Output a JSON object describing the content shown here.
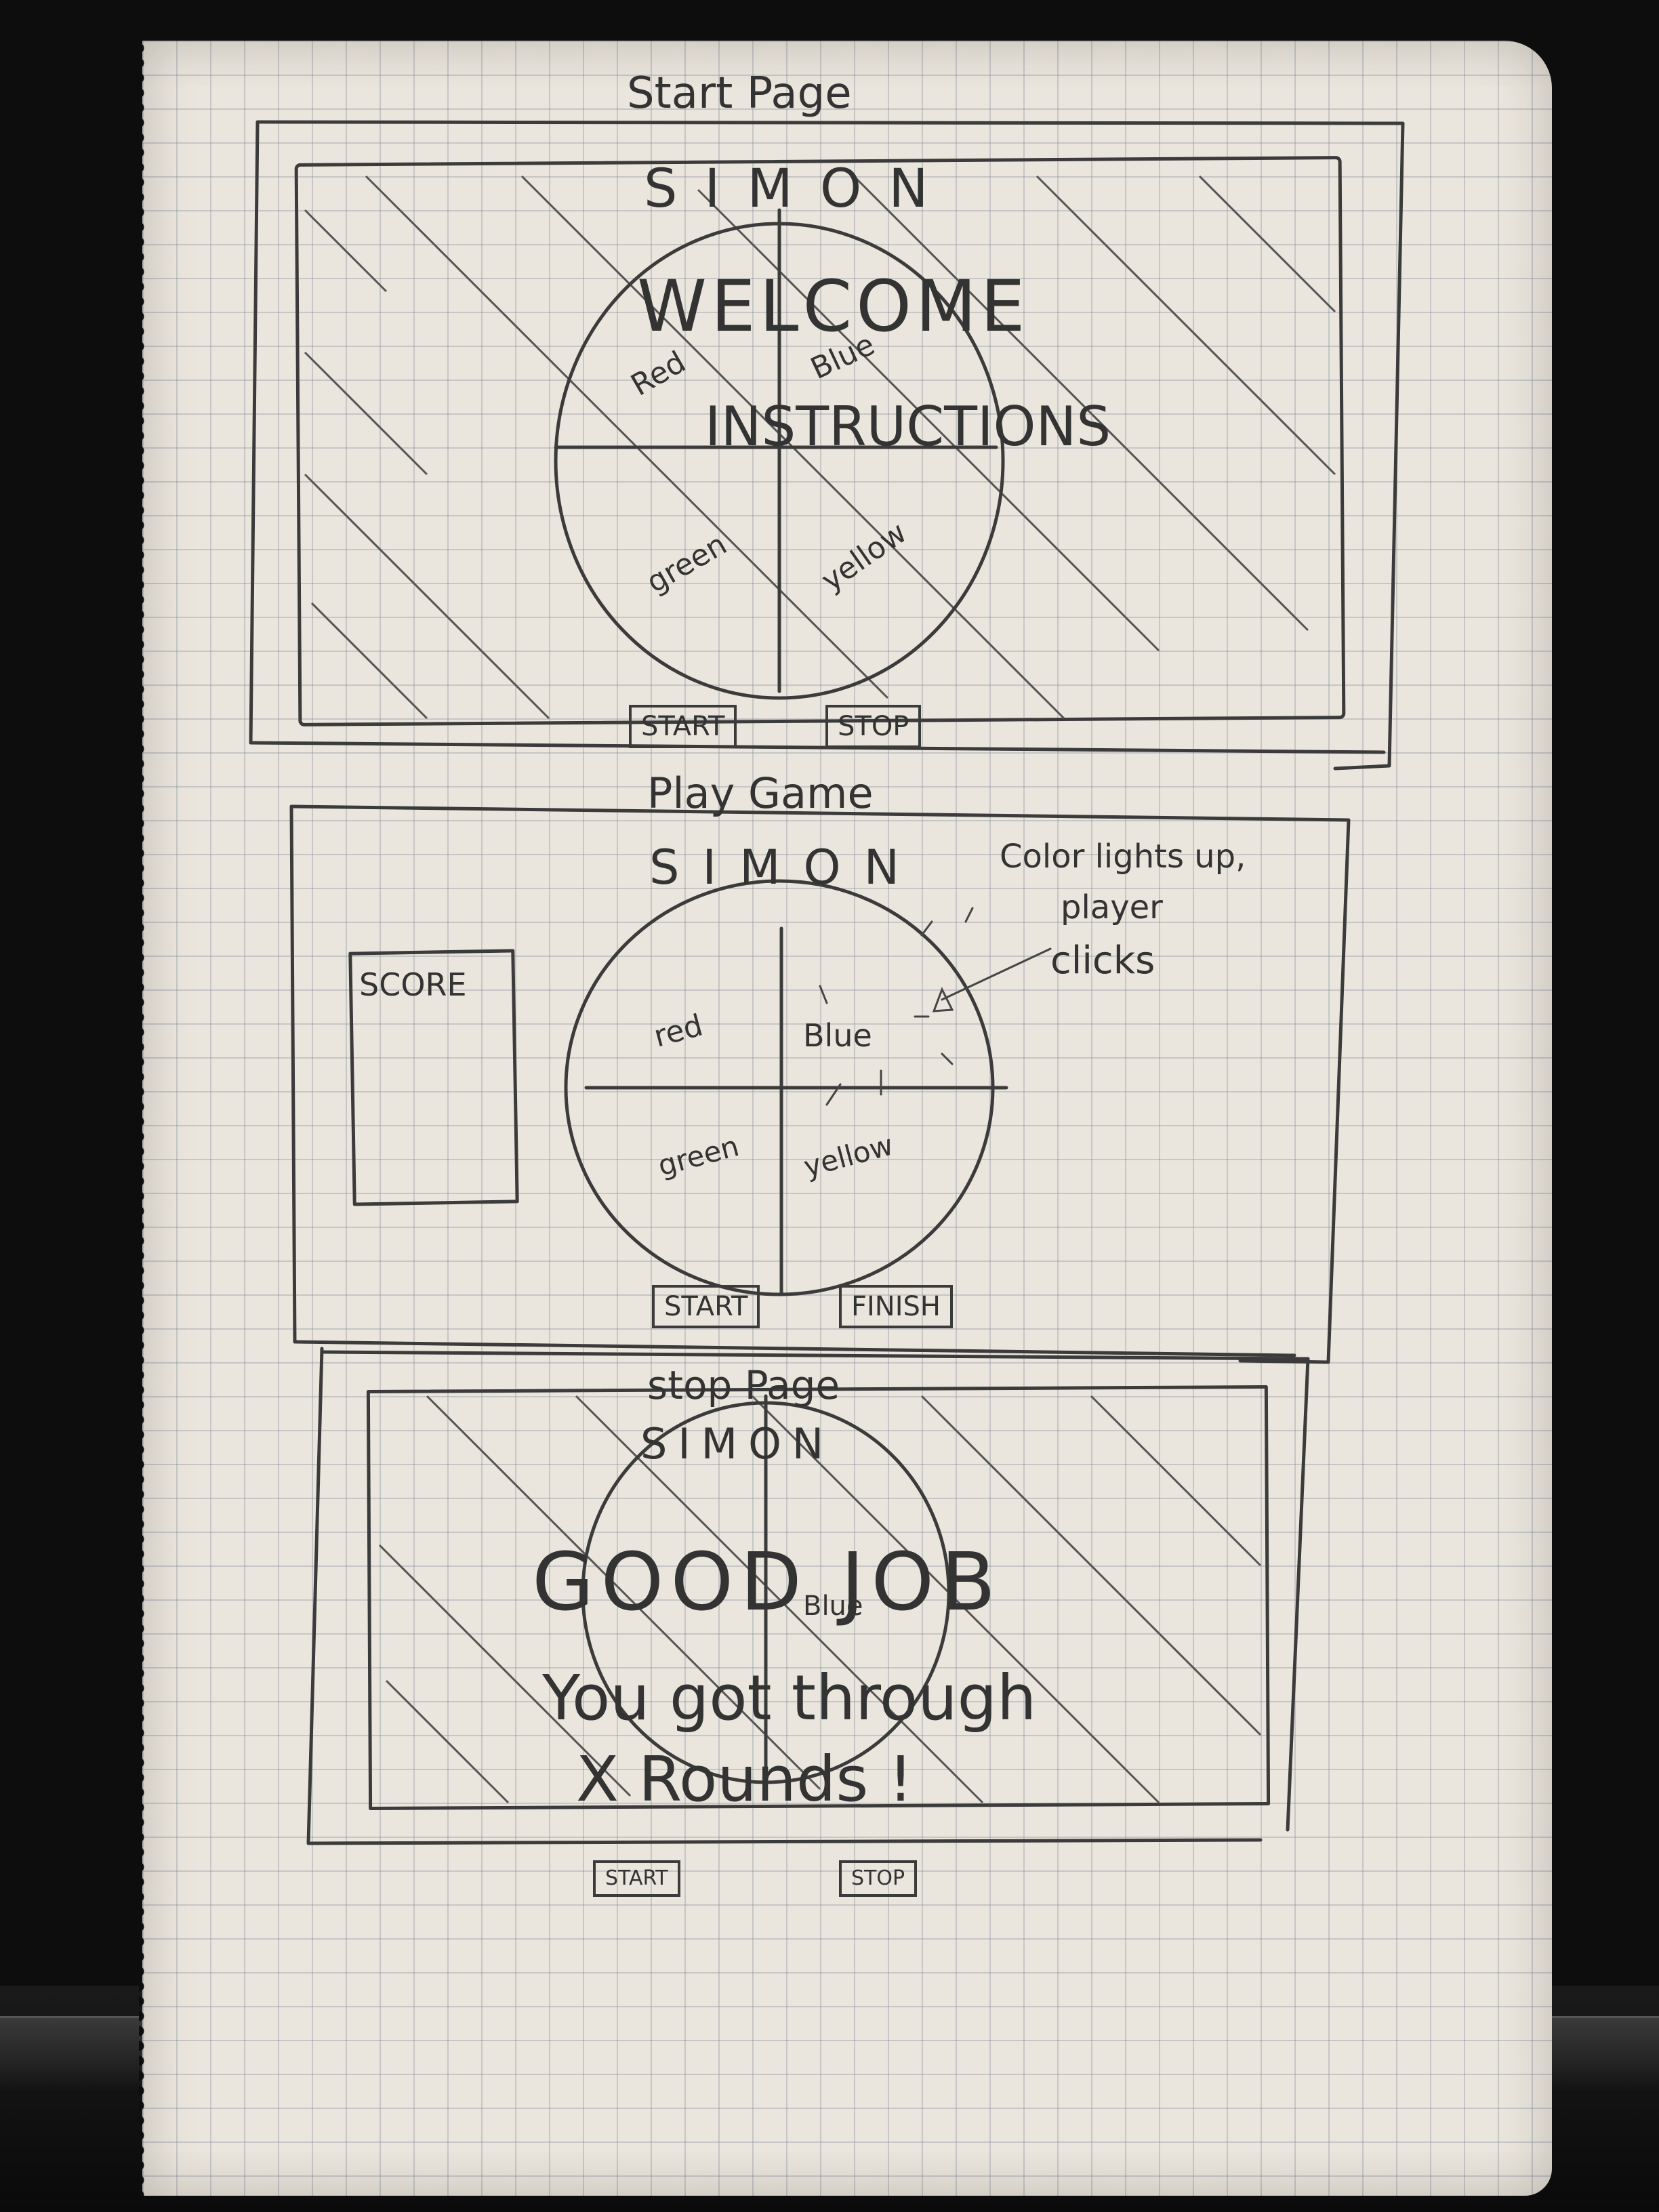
{
  "start_page": {
    "heading": "Start Page",
    "app_title": "SIMON",
    "welcome": "WELCOME",
    "instructions": "INSTRUCTIONS",
    "quadrants": {
      "red": "Red",
      "blue": "Blue",
      "green": "green",
      "yellow": "yellow"
    },
    "start_button": "START",
    "stop_button": "STOP"
  },
  "play_game": {
    "heading": "Play Game",
    "app_title": "SIMON",
    "score_label": "SCORE",
    "annotation": [
      "Color lights up,",
      "player",
      "clicks"
    ],
    "quadrants": {
      "red": "red",
      "blue": "Blue",
      "green": "green",
      "yellow": "yellow"
    },
    "start_button": "START",
    "finish_button": "FINISH"
  },
  "stop_page": {
    "heading": "stop Page",
    "app_title": "SIMON",
    "quadrant_blue": "Blue",
    "message_title": "GOOD JOB",
    "message_line1": "You got through",
    "message_line2": "X  Rounds !",
    "start_button": "START",
    "stop_button": "STOP"
  }
}
